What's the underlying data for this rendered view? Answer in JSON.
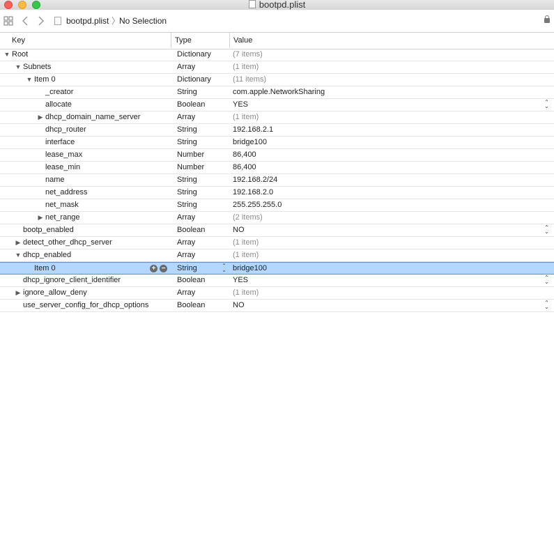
{
  "window": {
    "title": "bootpd.plist"
  },
  "jumpbar": {
    "file": "bootpd.plist",
    "separator": "〉",
    "selection": "No Selection"
  },
  "columns": {
    "key": "Key",
    "type": "Type",
    "value": "Value"
  },
  "rows": [
    {
      "key": "Root",
      "type": "Dictionary",
      "value": "(7 items)",
      "level": 0,
      "disclosure": "open",
      "dim": true
    },
    {
      "key": "Subnets",
      "type": "Array",
      "value": "(1 item)",
      "level": 1,
      "disclosure": "open",
      "dim": true
    },
    {
      "key": "Item 0",
      "type": "Dictionary",
      "value": "(11 items)",
      "level": 2,
      "disclosure": "open",
      "dim": true
    },
    {
      "key": "_creator",
      "type": "String",
      "value": "com.apple.NetworkSharing",
      "level": 3,
      "disclosure": "none"
    },
    {
      "key": "allocate",
      "type": "Boolean",
      "value": "YES",
      "level": 3,
      "disclosure": "none",
      "stepper": true
    },
    {
      "key": "dhcp_domain_name_server",
      "type": "Array",
      "value": "(1 item)",
      "level": 3,
      "disclosure": "closed",
      "dim": true
    },
    {
      "key": "dhcp_router",
      "type": "String",
      "value": "192.168.2.1",
      "level": 3,
      "disclosure": "none"
    },
    {
      "key": "interface",
      "type": "String",
      "value": "bridge100",
      "level": 3,
      "disclosure": "none"
    },
    {
      "key": "lease_max",
      "type": "Number",
      "value": "86,400",
      "level": 3,
      "disclosure": "none"
    },
    {
      "key": "lease_min",
      "type": "Number",
      "value": "86,400",
      "level": 3,
      "disclosure": "none"
    },
    {
      "key": "name",
      "type": "String",
      "value": "192.168.2/24",
      "level": 3,
      "disclosure": "none"
    },
    {
      "key": "net_address",
      "type": "String",
      "value": "192.168.2.0",
      "level": 3,
      "disclosure": "none"
    },
    {
      "key": "net_mask",
      "type": "String",
      "value": "255.255.255.0",
      "level": 3,
      "disclosure": "none"
    },
    {
      "key": "net_range",
      "type": "Array",
      "value": "(2 items)",
      "level": 3,
      "disclosure": "closed",
      "dim": true
    },
    {
      "key": "bootp_enabled",
      "type": "Boolean",
      "value": "NO",
      "level": 1,
      "disclosure": "none",
      "stepper": true
    },
    {
      "key": "detect_other_dhcp_server",
      "type": "Array",
      "value": "(1 item)",
      "level": 1,
      "disclosure": "closed",
      "dim": true
    },
    {
      "key": "dhcp_enabled",
      "type": "Array",
      "value": "(1 item)",
      "level": 1,
      "disclosure": "open",
      "dim": true
    },
    {
      "key": "Item 0",
      "type": "String",
      "value": "bridge100",
      "level": 2,
      "disclosure": "none",
      "selected": true
    },
    {
      "key": "dhcp_ignore_client_identifier",
      "type": "Boolean",
      "value": "YES",
      "level": 1,
      "disclosure": "none",
      "stepper": true
    },
    {
      "key": "ignore_allow_deny",
      "type": "Array",
      "value": "(1 item)",
      "level": 1,
      "disclosure": "closed",
      "dim": true
    },
    {
      "key": "use_server_config_for_dhcp_options",
      "type": "Boolean",
      "value": "NO",
      "level": 1,
      "disclosure": "none",
      "stepper": true
    }
  ]
}
